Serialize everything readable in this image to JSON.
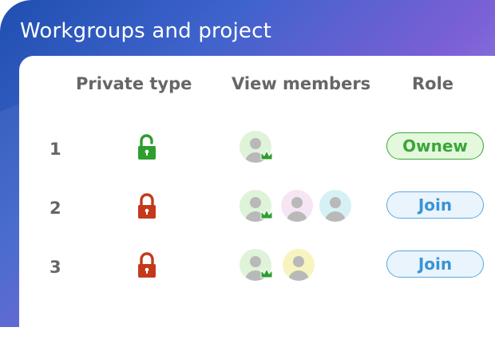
{
  "title": "Workgroups and project",
  "columns": {
    "private_type": "Private type",
    "view_members": "View members",
    "role": "Role"
  },
  "rows": [
    {
      "number": "1",
      "lock": {
        "state": "unlocked",
        "icon": "unlocked-padlock-icon",
        "color": "#2e9e2e"
      },
      "members": [
        {
          "color": "#dff3d8",
          "owner": true
        }
      ],
      "role": {
        "label": "Ownew",
        "style": "owner"
      }
    },
    {
      "number": "2",
      "lock": {
        "state": "locked",
        "icon": "locked-padlock-icon",
        "color": "#c4391b"
      },
      "members": [
        {
          "color": "#dff3d8",
          "owner": true
        },
        {
          "color": "#f6e6f3",
          "owner": false
        },
        {
          "color": "#d6f1f6",
          "owner": false
        }
      ],
      "role": {
        "label": "Join",
        "style": "join"
      }
    },
    {
      "number": "3",
      "lock": {
        "state": "locked",
        "icon": "locked-padlock-icon",
        "color": "#c4391b"
      },
      "members": [
        {
          "color": "#dff3d8",
          "owner": true
        },
        {
          "color": "#f8f4bf",
          "owner": false
        }
      ],
      "role": {
        "label": "Join",
        "style": "join"
      }
    }
  ],
  "colors": {
    "owner_badge": "#3aa636",
    "join_badge": "#3a93d6",
    "crown": "#2e9e2e",
    "person": "#b9b9b9"
  }
}
